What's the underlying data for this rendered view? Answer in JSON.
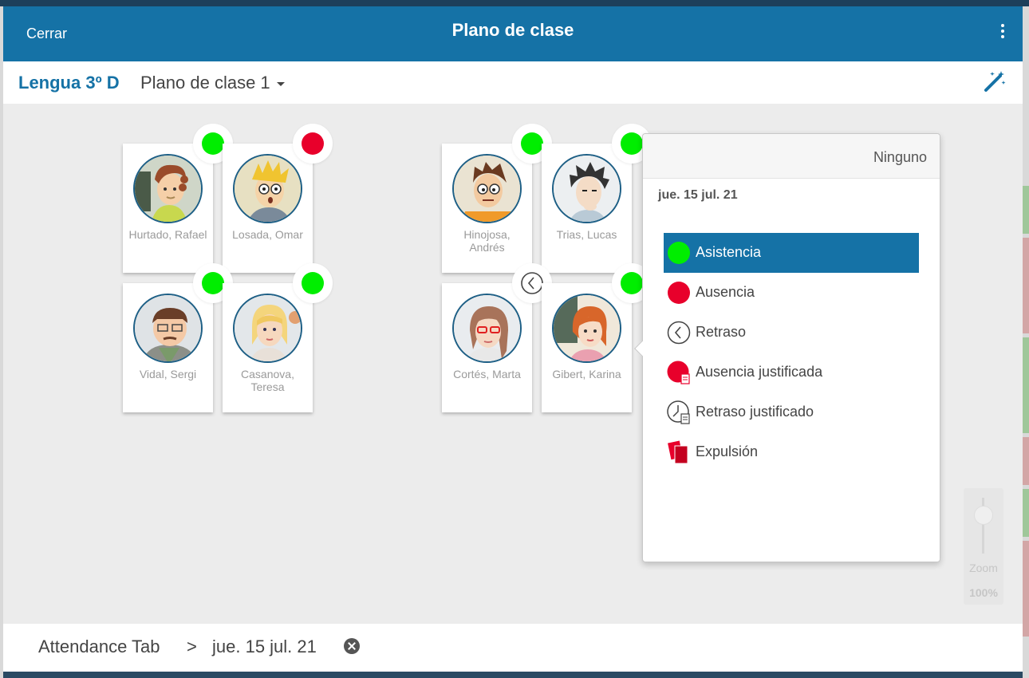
{
  "header": {
    "close_label": "Cerrar",
    "title": "Plano de clase"
  },
  "subbar": {
    "course": "Lengua 3º D",
    "plan": "Plano de clase 1"
  },
  "students": [
    {
      "name": "Hurtado, Rafael",
      "status": "green"
    },
    {
      "name": "Losada, Omar",
      "status": "red"
    },
    {
      "name": "Vidal, Sergi",
      "status": "green"
    },
    {
      "name": "Casanova, Teresa",
      "status": "green"
    },
    {
      "name": "Hinojosa, Andrés",
      "status": "green"
    },
    {
      "name": "Trias, Lucas",
      "status": "green"
    },
    {
      "name": "Cortés, Marta",
      "status": "late"
    },
    {
      "name": "Gibert, Karina",
      "status": "green"
    }
  ],
  "popover": {
    "none_label": "Ninguno",
    "date": "jue. 15 jul. 21",
    "options": [
      {
        "label": "Asistencia",
        "icon": "green-dot-icon",
        "selected": true
      },
      {
        "label": "Ausencia",
        "icon": "red-dot-icon"
      },
      {
        "label": "Retraso",
        "icon": "clock-icon"
      },
      {
        "label": "Ausencia justificada",
        "icon": "red-dot-document-icon"
      },
      {
        "label": "Retraso justificado",
        "icon": "clock-document-icon"
      },
      {
        "label": "Expulsión",
        "icon": "red-cards-icon"
      }
    ]
  },
  "zoom": {
    "label": "Zoom",
    "value": "100%"
  },
  "footer": {
    "crumb1": "Attendance Tab",
    "separator": ">",
    "crumb2": "jue. 15 jul. 21"
  },
  "colors": {
    "primary": "#1572a6",
    "present": "#00ee00",
    "absent": "#e8002b"
  }
}
